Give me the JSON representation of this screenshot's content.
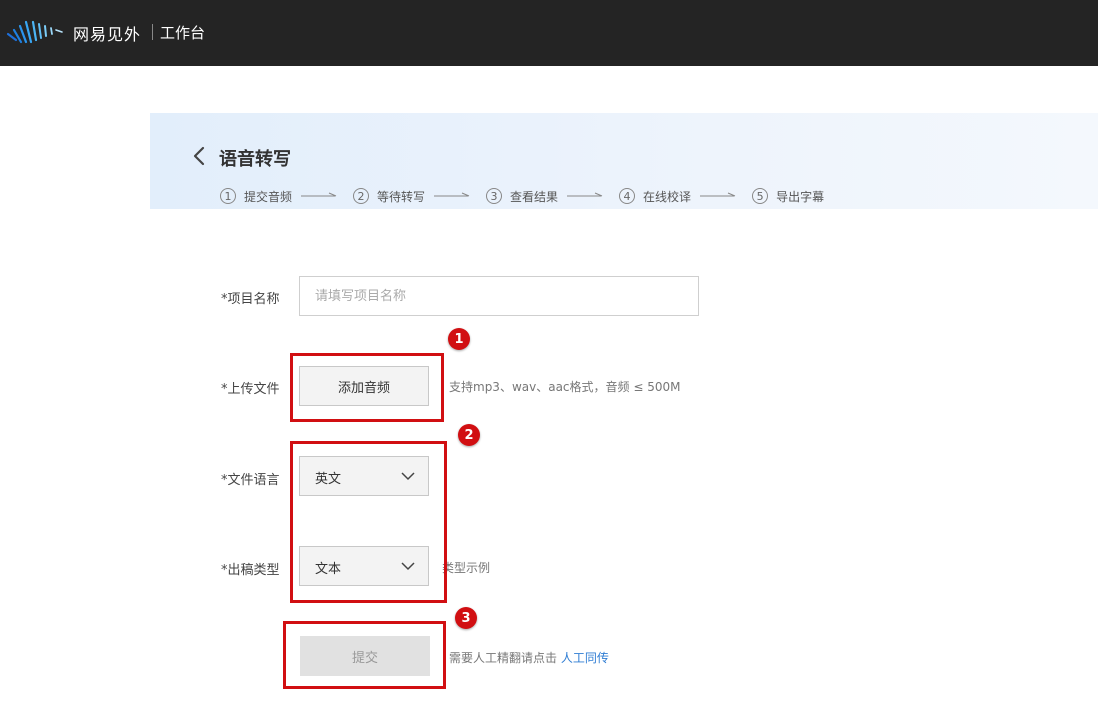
{
  "topbar": {
    "brand": "网易见外",
    "workbench": "工作台"
  },
  "header": {
    "title": "语音转写",
    "steps": [
      {
        "num": "1",
        "label": "提交音频"
      },
      {
        "num": "2",
        "label": "等待转写"
      },
      {
        "num": "3",
        "label": "查看结果"
      },
      {
        "num": "4",
        "label": "在线校译"
      },
      {
        "num": "5",
        "label": "导出字幕"
      }
    ]
  },
  "form": {
    "project_name_label": "*项目名称",
    "project_name_placeholder": "请填写项目名称",
    "upload_label": "*上传文件",
    "upload_button": "添加音频",
    "upload_hint": "支持mp3、wav、aac格式，音频 ≤ 500M",
    "language_label": "*文件语言",
    "language_value": "英文",
    "output_type_label": "*出稿类型",
    "output_type_value": "文本",
    "output_type_hint": "类型示例",
    "submit_button": "提交",
    "manual_hint": "需要人工精翻请点击",
    "manual_link": "人工同传"
  },
  "annotations": {
    "badges": [
      "1",
      "2",
      "3"
    ],
    "color": "#d10f12"
  },
  "colors": {
    "topbar": "#242424",
    "link": "#2f7dd3",
    "header_panel": "#e2eefb"
  }
}
